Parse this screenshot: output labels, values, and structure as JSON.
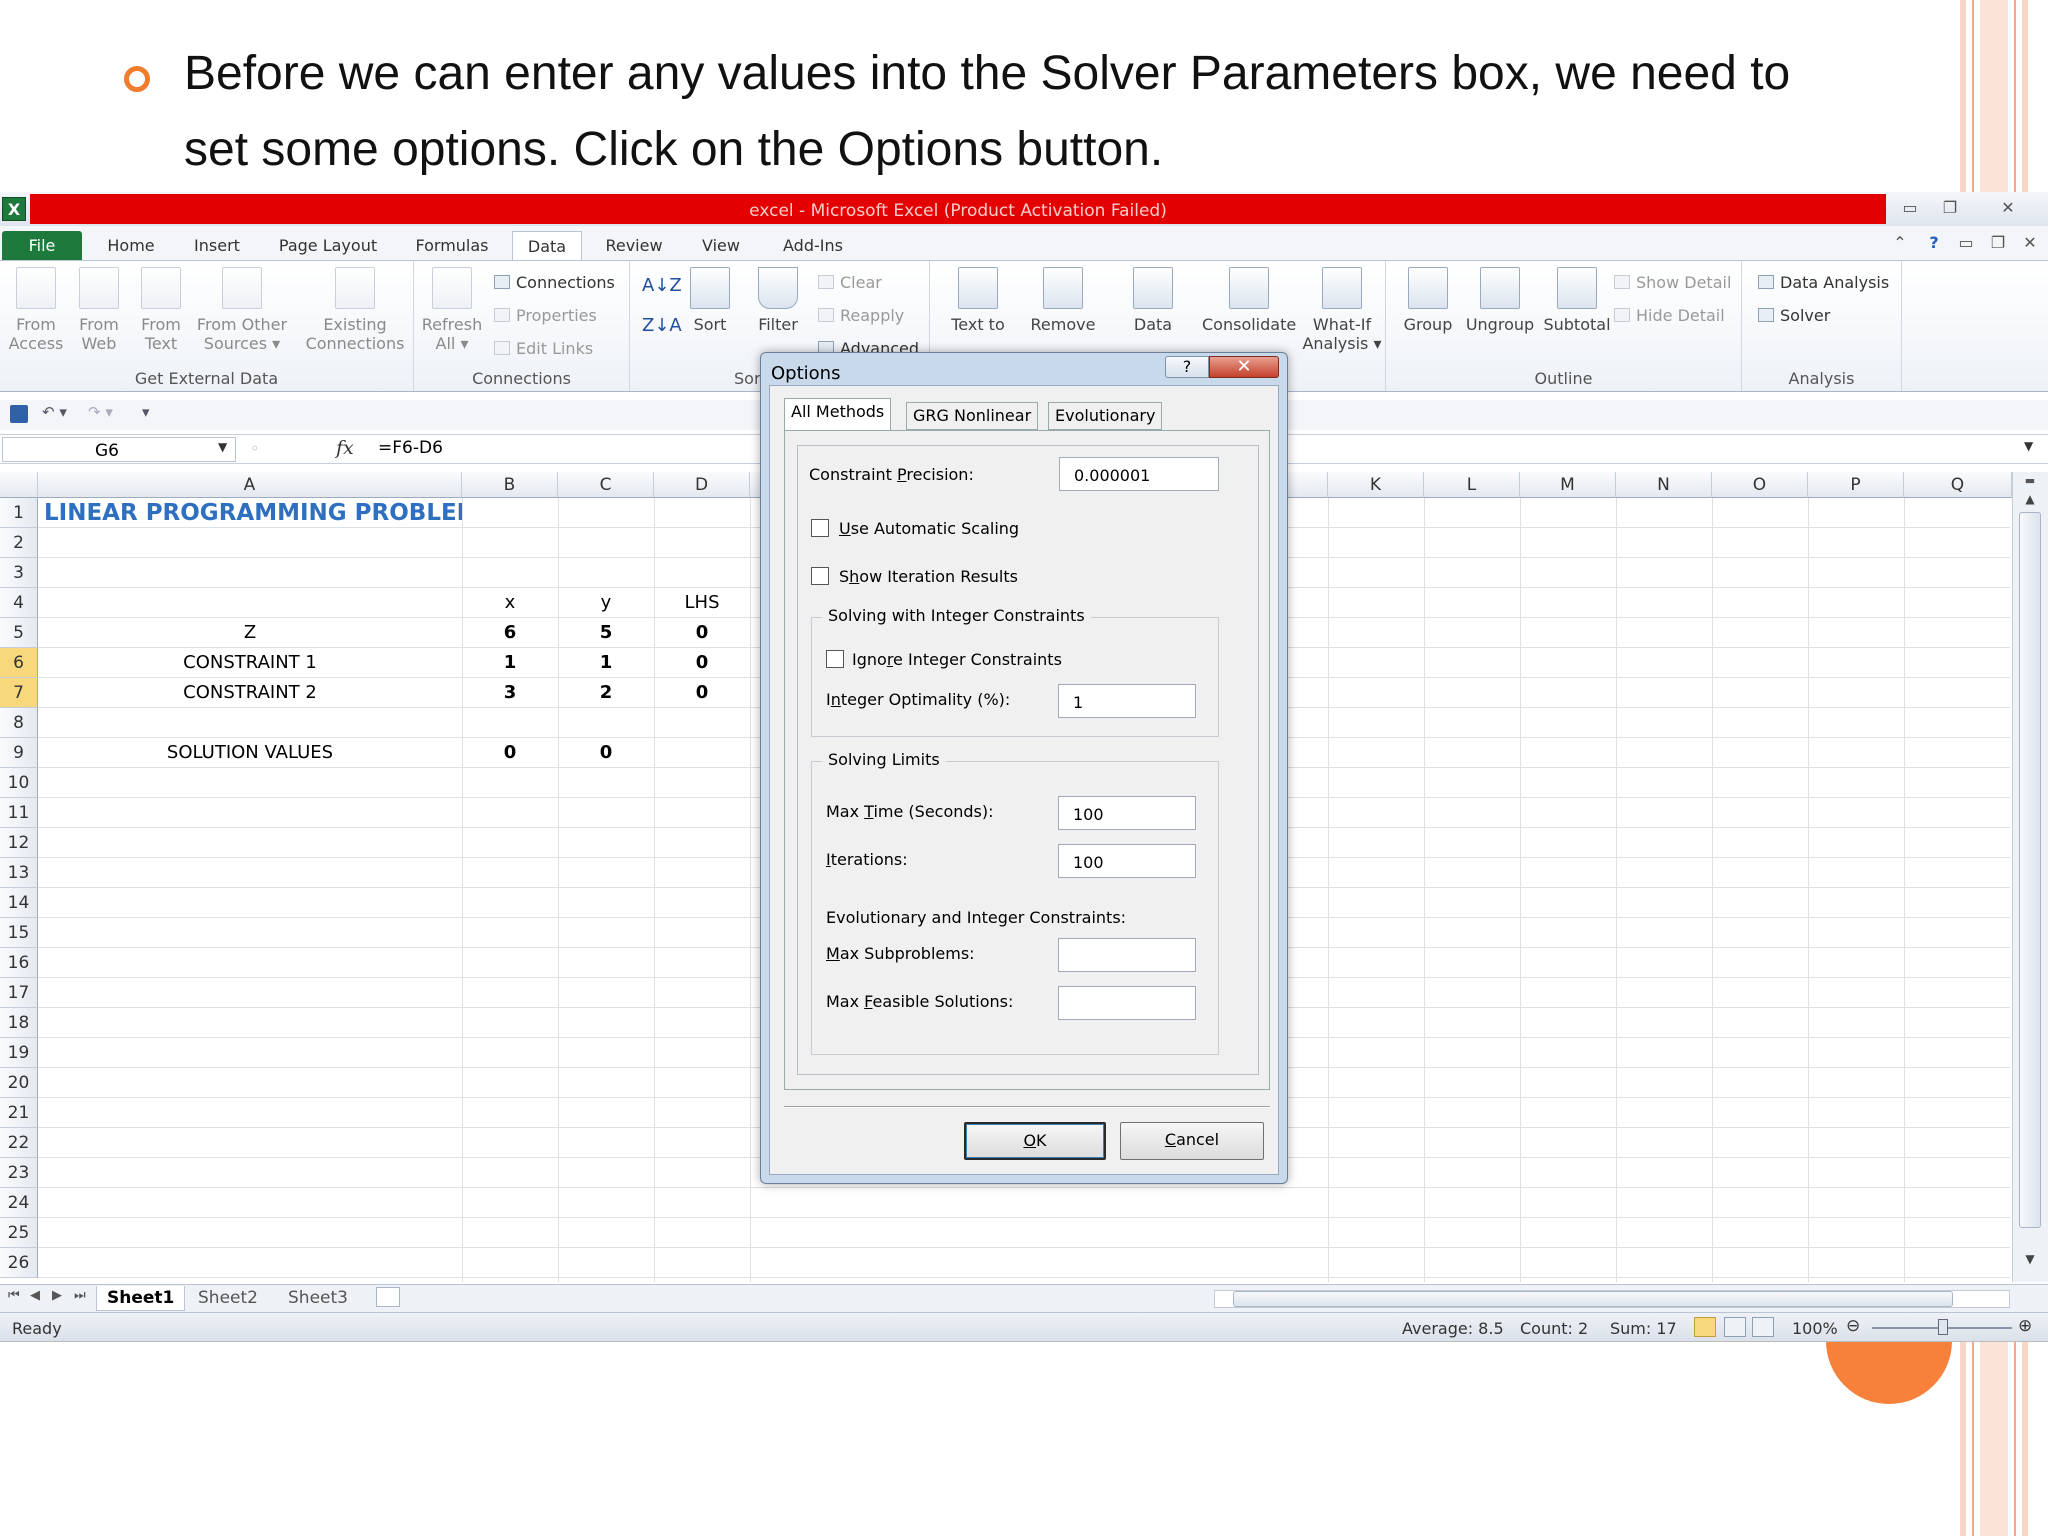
{
  "slide": {
    "caption_line1": "Before we can enter any values into the Solver Parameters box, we need to",
    "caption_line2": "set some options. Click on the Options button.",
    "accent_color": "#f07c2e"
  },
  "excel": {
    "title": "excel  -  Microsoft Excel (Product Activation Failed)",
    "title_bar_color": "#e30000",
    "tabs": [
      "File",
      "Home",
      "Insert",
      "Page Layout",
      "Formulas",
      "Data",
      "Review",
      "View",
      "Add-Ins"
    ],
    "active_tab": "Data",
    "ribbon": {
      "get_external_data": {
        "label": "Get External Data",
        "from_access": [
          "From",
          "Access"
        ],
        "from_web": [
          "From",
          "Web"
        ],
        "from_text": [
          "From",
          "Text"
        ],
        "from_other": [
          "From Other",
          "Sources ▾"
        ],
        "existing": [
          "Existing",
          "Connections"
        ]
      },
      "connections": {
        "label": "Connections",
        "refresh": [
          "Refresh",
          "All ▾"
        ],
        "connections": "Connections",
        "properties": "Properties",
        "edit_links": "Edit Links"
      },
      "sort_filter": {
        "label": "Sor",
        "sort": "Sort",
        "filter": "Filter",
        "clear": "Clear",
        "reapply": "Reapply",
        "advanced": "Advanced"
      },
      "data_tools": {
        "text_to": "Text to",
        "remove": "Remove",
        "data": "Data",
        "consolidate": "Consolidate",
        "what_if": [
          "What-If",
          "Analysis ▾"
        ]
      },
      "outline": {
        "label": "Outline",
        "group": "Group",
        "ungroup": "Ungroup",
        "subtotal": "Subtotal",
        "show_detail": "Show Detail",
        "hide_detail": "Hide Detail"
      },
      "analysis": {
        "label": "Analysis",
        "data_analysis": "Data Analysis",
        "solver": "Solver"
      }
    },
    "name_box": "G6",
    "formula": "=F6-D6",
    "fx_symbol": "fx",
    "columns": [
      "A",
      "B",
      "C",
      "D",
      "K",
      "L",
      "M",
      "N",
      "O",
      "P",
      "Q"
    ],
    "rows": [
      "1",
      "2",
      "3",
      "4",
      "5",
      "6",
      "7",
      "8",
      "9",
      "10",
      "11",
      "12",
      "13",
      "14",
      "15",
      "16",
      "17",
      "18",
      "19",
      "20",
      "21",
      "22",
      "23",
      "24",
      "25",
      "26"
    ],
    "cells": {
      "a1": "LINEAR PROGRAMMING PROBLEM",
      "b4": "x",
      "c4": "y",
      "d4": "LHS",
      "a5": "Z",
      "b5": "6",
      "c5": "5",
      "d5": "0",
      "a6": "CONSTRAINT 1",
      "b6": "1",
      "c6": "1",
      "d6": "0",
      "a7": "CONSTRAINT 2",
      "b7": "3",
      "c7": "2",
      "d7": "0",
      "a9": "SOLUTION VALUES",
      "b9": "0",
      "c9": "0"
    },
    "sheets": [
      "Sheet1",
      "Sheet2",
      "Sheet3"
    ],
    "status": {
      "ready": "Ready",
      "average": "Average: 8.5",
      "count": "Count: 2",
      "sum": "Sum: 17",
      "zoom": "100%"
    }
  },
  "dialog": {
    "title": "Options",
    "help": "?",
    "close": "✕",
    "tabs": [
      "All Methods",
      "GRG Nonlinear",
      "Evolutionary"
    ],
    "constraint_precision": {
      "pre": "Constraint ",
      "key": "P",
      "post": "recision:",
      "value": "0.000001"
    },
    "auto_scaling": {
      "key": "U",
      "post": "se Automatic Scaling"
    },
    "iteration_results": {
      "pre": "S",
      "key": "h",
      "post": "ow Iteration Results"
    },
    "integer_group": "Solving with Integer Constraints",
    "ignore_integer": {
      "pre": "Igno",
      "key": "r",
      "post": "e Integer Constraints"
    },
    "integer_optimality": {
      "pre": "I",
      "key": "n",
      "post": "teger Optimality (%):",
      "value": "1"
    },
    "limits_group": "Solving Limits",
    "max_time": {
      "pre": "Max ",
      "key": "T",
      "post": "ime (Seconds):",
      "value": "100"
    },
    "iterations": {
      "pre": "",
      "key": "I",
      "post": "terations:",
      "value": "100"
    },
    "evo_heading": "Evolutionary and Integer Constraints:",
    "max_subproblems": {
      "pre": "",
      "key": "M",
      "post": "ax Subproblems:"
    },
    "max_feasible": {
      "pre": "Max ",
      "key": "F",
      "post": "easible Solutions:"
    },
    "ok": {
      "key": "O",
      "post": "K"
    },
    "cancel": {
      "key": "C",
      "post": "ancel"
    }
  }
}
